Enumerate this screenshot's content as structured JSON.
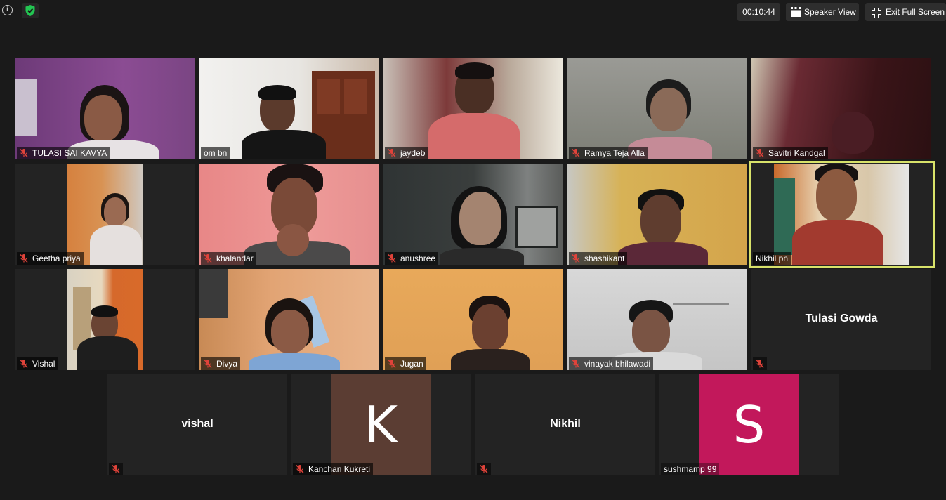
{
  "toolbar": {
    "timer": "00:10:44",
    "speaker_view_label": "Speaker View",
    "exit_full_screen_label": "Exit Full Screen"
  },
  "colors": {
    "background": "#1a1a1a",
    "tile_background": "#232323",
    "active_speaker_border": "#d8e26a",
    "muted_icon": "#e0433a",
    "avatar_k": "#5b3d33",
    "avatar_s": "#c2185b"
  },
  "participants": [
    {
      "name": "TULASI SAI KAVYA",
      "muted": true,
      "video": true
    },
    {
      "name": "om bn",
      "muted": false,
      "video": true
    },
    {
      "name": "jaydeb",
      "muted": true,
      "video": true
    },
    {
      "name": "Ramya Teja Alla",
      "muted": true,
      "video": true
    },
    {
      "name": "Savitri Kandgal",
      "muted": true,
      "video": true
    },
    {
      "name": "Geetha priya",
      "muted": true,
      "video": true
    },
    {
      "name": "khalandar",
      "muted": true,
      "video": true
    },
    {
      "name": "anushree",
      "muted": true,
      "video": true
    },
    {
      "name": "shashikant",
      "muted": true,
      "video": true
    },
    {
      "name": "Nikhil pn",
      "muted": false,
      "video": true,
      "active_speaker": true
    },
    {
      "name": "Vishal",
      "muted": true,
      "video": true
    },
    {
      "name": "Divya",
      "muted": true,
      "video": true
    },
    {
      "name": "Jugan",
      "muted": true,
      "video": true
    },
    {
      "name": "vinayak bhilawadi",
      "muted": true,
      "video": true
    },
    {
      "name": "Tulasi Gowda",
      "muted": true,
      "video": false
    },
    {
      "name": "vishal",
      "muted": true,
      "video": false
    },
    {
      "name": "Kanchan Kukreti",
      "muted": true,
      "video": false,
      "avatar_letter": "K"
    },
    {
      "name": "Nikhil",
      "muted": true,
      "video": false
    },
    {
      "name": "sushmamp 99",
      "muted": true,
      "video": false,
      "avatar_letter": "S"
    }
  ]
}
